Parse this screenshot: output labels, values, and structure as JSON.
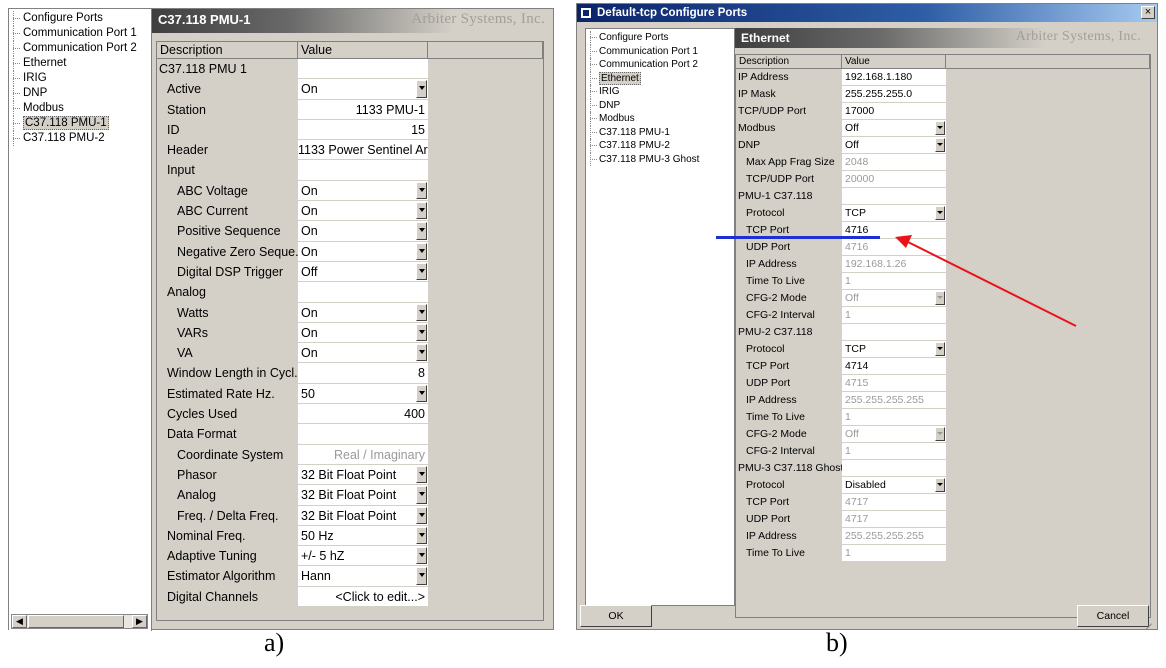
{
  "panel_a": {
    "tree": [
      "Configure Ports",
      "Communication Port 1",
      "Communication Port 2",
      "Ethernet",
      "IRIG",
      "DNP",
      "Modbus",
      "C37.118 PMU-1",
      "C37.118 PMU-2"
    ],
    "selected_tree_item": "C37.118 PMU-1",
    "header_title": "C37.118 PMU-1",
    "brand": "Arbiter Systems, Inc.",
    "col_description": "Description",
    "col_value": "Value",
    "rows": [
      {
        "d": "C37.118 PMU 1",
        "v": "",
        "indent": 0
      },
      {
        "d": "Active",
        "v": "On",
        "indent": 1,
        "dd": true,
        "align": "left"
      },
      {
        "d": "Station",
        "v": "1133 PMU-1",
        "indent": 1,
        "align": "right"
      },
      {
        "d": "ID",
        "v": "15",
        "indent": 1,
        "align": "right"
      },
      {
        "d": "Header",
        "v": "1133 Power Sentinel Ar...",
        "indent": 1,
        "align": "right"
      },
      {
        "d": "Input",
        "v": "",
        "indent": 1
      },
      {
        "d": "ABC Voltage",
        "v": "On",
        "indent": 2,
        "dd": true,
        "align": "left"
      },
      {
        "d": "ABC Current",
        "v": "On",
        "indent": 2,
        "dd": true,
        "align": "left"
      },
      {
        "d": "Positive Sequence",
        "v": "On",
        "indent": 2,
        "dd": true,
        "align": "left"
      },
      {
        "d": "Negative Zero Seque...",
        "v": "On",
        "indent": 2,
        "dd": true,
        "align": "left"
      },
      {
        "d": "Digital DSP Trigger",
        "v": "Off",
        "indent": 2,
        "dd": true,
        "align": "left"
      },
      {
        "d": "Analog",
        "v": "",
        "indent": 1
      },
      {
        "d": "Watts",
        "v": "On",
        "indent": 2,
        "dd": true,
        "align": "left"
      },
      {
        "d": "VARs",
        "v": "On",
        "indent": 2,
        "dd": true,
        "align": "left"
      },
      {
        "d": "VA",
        "v": "On",
        "indent": 2,
        "dd": true,
        "align": "left"
      },
      {
        "d": "Window Length in Cycl...",
        "v": "8",
        "indent": 1,
        "align": "right"
      },
      {
        "d": "Estimated Rate Hz.",
        "v": "50",
        "indent": 1,
        "dd": true,
        "align": "left"
      },
      {
        "d": "Cycles Used",
        "v": "400",
        "indent": 1,
        "align": "right"
      },
      {
        "d": "Data Format",
        "v": "",
        "indent": 1
      },
      {
        "d": "Coordinate System",
        "v": "Real / Imaginary",
        "indent": 2,
        "align": "right",
        "ro": true
      },
      {
        "d": "Phasor",
        "v": "32 Bit Float Point",
        "indent": 2,
        "dd": true,
        "align": "left"
      },
      {
        "d": "Analog",
        "v": "32 Bit Float Point",
        "indent": 2,
        "dd": true,
        "align": "left"
      },
      {
        "d": "Freq. / Delta Freq.",
        "v": "32 Bit Float Point",
        "indent": 2,
        "dd": true,
        "align": "left"
      },
      {
        "d": "Nominal Freq.",
        "v": "50 Hz",
        "indent": 1,
        "dd": true,
        "align": "left"
      },
      {
        "d": "Adaptive Tuning",
        "v": "+/- 5 hZ",
        "indent": 1,
        "dd": true,
        "align": "left"
      },
      {
        "d": "Estimator Algorithm",
        "v": "Hann",
        "indent": 1,
        "dd": true,
        "align": "left"
      },
      {
        "d": "Digital Channels",
        "v": "<Click to edit...>",
        "indent": 1,
        "align": "right"
      }
    ],
    "caption": "a)"
  },
  "panel_b": {
    "window_title": "Default-tcp Configure Ports",
    "close_glyph": "×",
    "tree": [
      "Configure Ports",
      "Communication Port 1",
      "Communication Port 2",
      "Ethernet",
      "IRIG",
      "DNP",
      "Modbus",
      "C37.118 PMU-1",
      "C37.118 PMU-2",
      "C37.118 PMU-3 Ghost"
    ],
    "selected_tree_item": "Ethernet",
    "header_title": "Ethernet",
    "brand": "Arbiter Systems, Inc.",
    "col_description": "Description",
    "col_value": "Value",
    "rows": [
      {
        "d": "IP Address",
        "v": "192.168.1.180",
        "indent": 0
      },
      {
        "d": "IP Mask",
        "v": "255.255.255.0",
        "indent": 0
      },
      {
        "d": "TCP/UDP Port",
        "v": "17000",
        "indent": 0
      },
      {
        "d": "Modbus",
        "v": "Off",
        "indent": 0,
        "dd": true
      },
      {
        "d": "DNP",
        "v": "Off",
        "indent": 0,
        "dd": true
      },
      {
        "d": "Max App Frag Size",
        "v": "2048",
        "indent": 1,
        "ro": true
      },
      {
        "d": "TCP/UDP Port",
        "v": "20000",
        "indent": 1,
        "ro": true
      },
      {
        "d": "PMU-1 C37.118",
        "v": "",
        "indent": 0
      },
      {
        "d": "Protocol",
        "v": "TCP",
        "indent": 1,
        "dd": true
      },
      {
        "d": "TCP Port",
        "v": "4716",
        "indent": 1
      },
      {
        "d": "UDP Port",
        "v": "4716",
        "indent": 1,
        "ro": true
      },
      {
        "d": "IP Address",
        "v": "192.168.1.26",
        "indent": 1,
        "ro": true
      },
      {
        "d": "Time To Live",
        "v": "1",
        "indent": 1,
        "ro": true
      },
      {
        "d": "CFG-2 Mode",
        "v": "Off",
        "indent": 1,
        "ro": true,
        "dd": true,
        "dis": true
      },
      {
        "d": "CFG-2 Interval",
        "v": "1",
        "indent": 1,
        "ro": true
      },
      {
        "d": "PMU-2 C37.118",
        "v": "",
        "indent": 0
      },
      {
        "d": "Protocol",
        "v": "TCP",
        "indent": 1,
        "dd": true
      },
      {
        "d": "TCP Port",
        "v": "4714",
        "indent": 1
      },
      {
        "d": "UDP Port",
        "v": "4715",
        "indent": 1,
        "ro": true
      },
      {
        "d": "IP Address",
        "v": "255.255.255.255",
        "indent": 1,
        "ro": true
      },
      {
        "d": "Time To Live",
        "v": "1",
        "indent": 1,
        "ro": true
      },
      {
        "d": "CFG-2 Mode",
        "v": "Off",
        "indent": 1,
        "ro": true,
        "dd": true,
        "dis": true
      },
      {
        "d": "CFG-2 Interval",
        "v": "1",
        "indent": 1,
        "ro": true
      },
      {
        "d": "PMU-3 C37.118 Ghost",
        "v": "",
        "indent": 0
      },
      {
        "d": "Protocol",
        "v": "Disabled",
        "indent": 1,
        "dd": true
      },
      {
        "d": "TCP Port",
        "v": "4717",
        "indent": 1,
        "ro": true
      },
      {
        "d": "UDP Port",
        "v": "4717",
        "indent": 1,
        "ro": true
      },
      {
        "d": "IP Address",
        "v": "255.255.255.255",
        "indent": 1,
        "ro": true
      },
      {
        "d": "Time To Live",
        "v": "1",
        "indent": 1,
        "ro": true
      }
    ],
    "ok_label": "OK",
    "cancel_label": "Cancel",
    "caption": "b)"
  },
  "annotation_colors": {
    "underline": "#1f2fd6",
    "arrow": "#e8141a"
  }
}
